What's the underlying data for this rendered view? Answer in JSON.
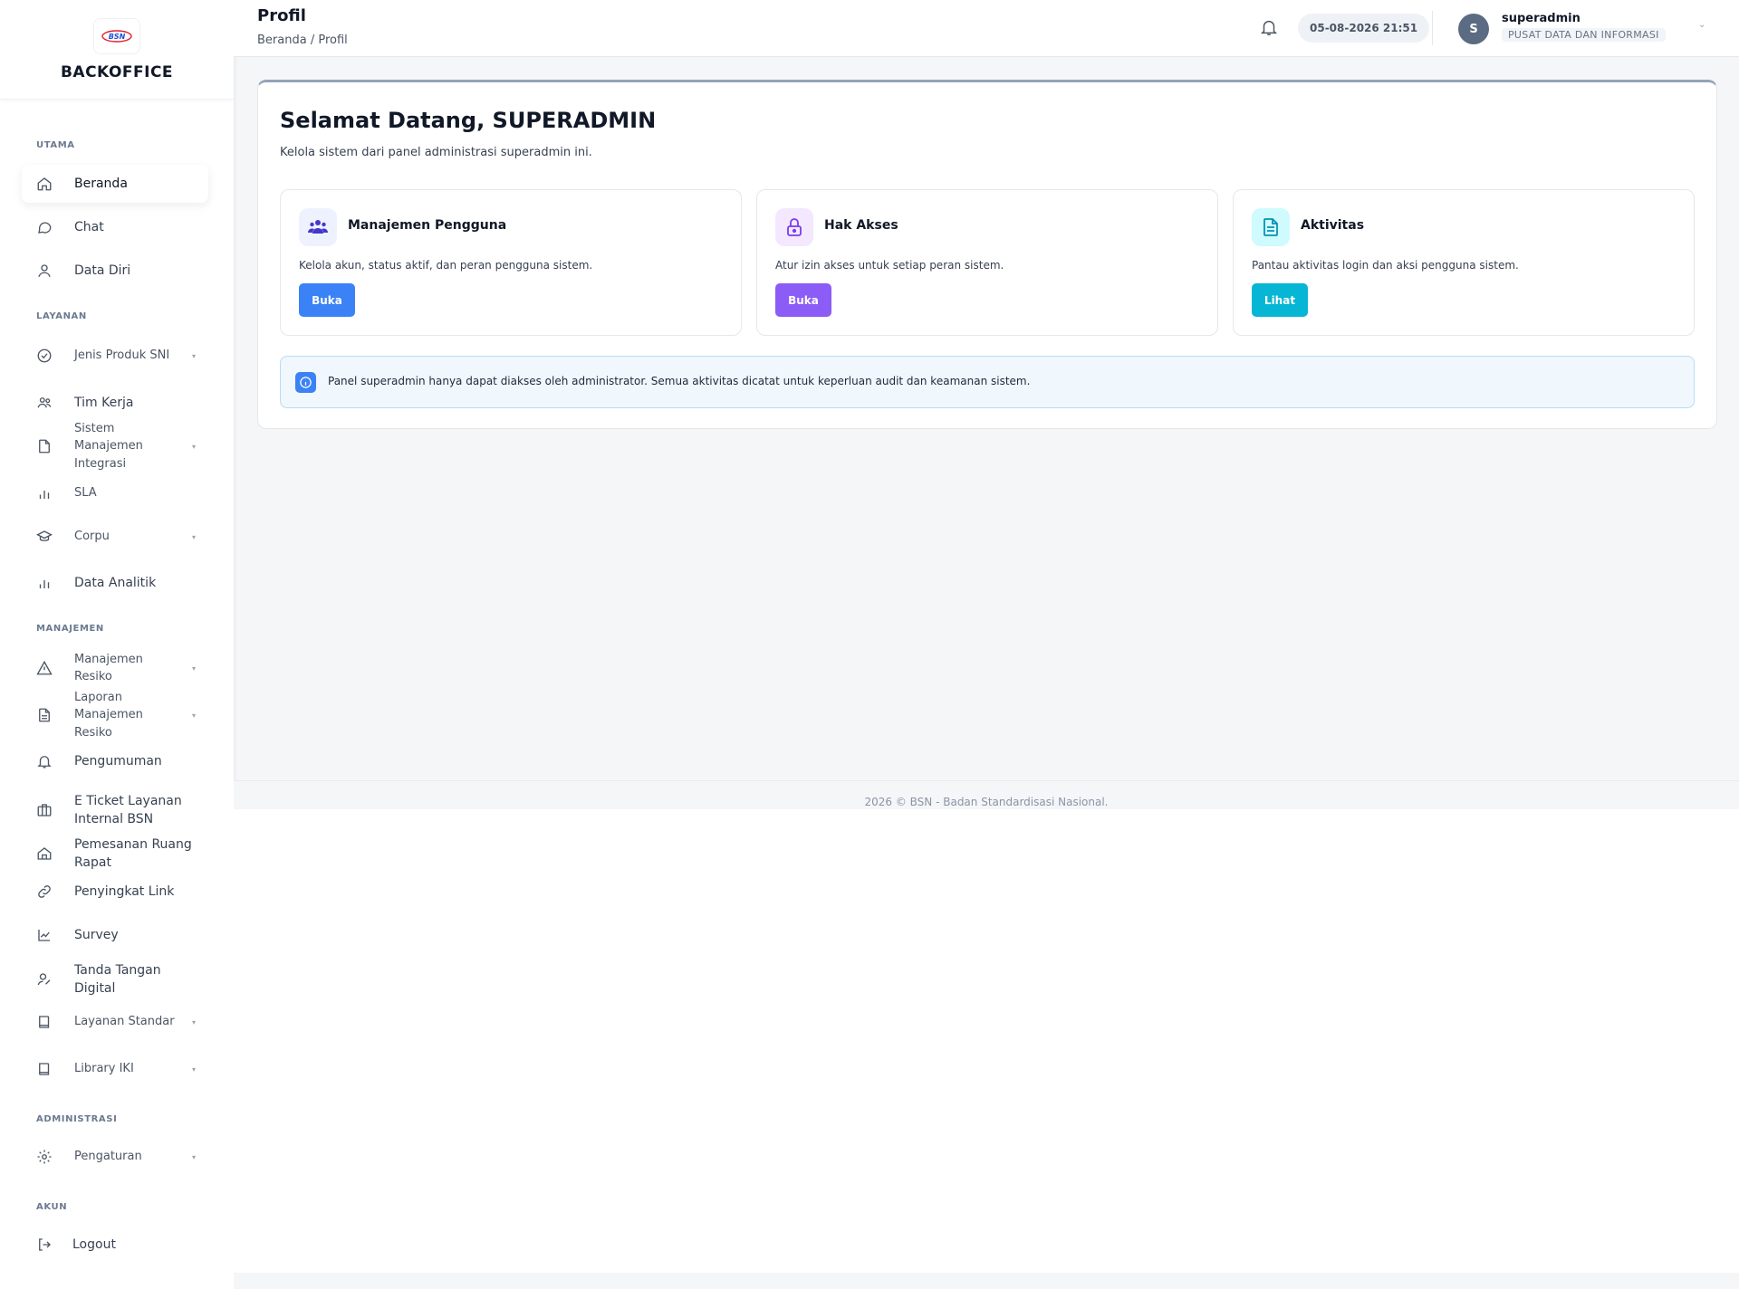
{
  "brand": {
    "logo_text": "BSN",
    "name": "BACKOFFICE"
  },
  "sidebar": {
    "sections": {
      "utama": "UTAMA",
      "layanan": "LAYANAN",
      "manajemen": "MANAJEMEN",
      "administrasi": "ADMINISTRASI",
      "akun": "AKUN"
    },
    "items": {
      "beranda": "Beranda",
      "chat": "Chat",
      "data_diri": "Data Diri",
      "jenis_produk": "Jenis Produk SNI",
      "tim_kerja": "Tim Kerja",
      "smi": "Sistem Manajemen Integrasi",
      "sla": "SLA",
      "corpu": "Corpu",
      "data_analitik": "Data Analitik",
      "manajemen_resiko": "Manajemen Resiko",
      "laporan_resiko": "Laporan Manajemen Resiko",
      "pengumuman": "Pengumuman",
      "eticket": "E Ticket Layanan Internal BSN",
      "pemesanan": "Pemesanan Ruang Rapat",
      "penyingkat": "Penyingkat Link",
      "survey": "Survey",
      "ttd": "Tanda Tangan Digital",
      "layanan_standar": "Layanan Standar",
      "library_iki": "Library IKI",
      "pengaturan": "Pengaturan",
      "logout": "Logout"
    },
    "active": "beranda"
  },
  "header": {
    "title": "Profil",
    "breadcrumb": "Beranda / Profil",
    "datetime": "05-08-2026 21:51",
    "user": {
      "initial": "S",
      "name": "superadmin",
      "org": "PUSAT DATA DAN INFORMASI"
    }
  },
  "main": {
    "welcome": "Selamat Datang, SUPERADMIN",
    "subtitle": "Kelola sistem dari panel administrasi superadmin ini.",
    "cards": [
      {
        "title": "Manajemen Pengguna",
        "desc": "Kelola akun, status aktif, dan peran pengguna sistem.",
        "button": "Buka",
        "icon": "users-icon",
        "color": "#3b82f6"
      },
      {
        "title": "Hak Akses",
        "desc": "Atur izin akses untuk setiap peran sistem.",
        "button": "Buka",
        "icon": "lock-icon",
        "color": "#8b5cf6"
      },
      {
        "title": "Aktivitas",
        "desc": "Pantau aktivitas login dan aksi pengguna sistem.",
        "button": "Lihat",
        "icon": "document-icon",
        "color": "#06b6d4"
      }
    ],
    "alert": "Panel superadmin hanya dapat diakses oleh administrator. Semua aktivitas dicatat untuk keperluan audit dan keamanan sistem."
  },
  "footer": {
    "text": "2026 © BSN - Badan Standardisasi Nasional."
  }
}
